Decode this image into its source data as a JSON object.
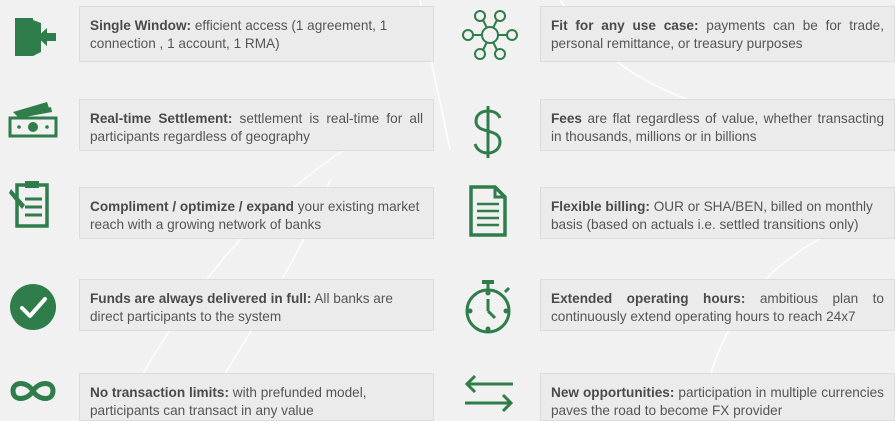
{
  "colors": {
    "green": "#2e7d4a",
    "text": "#555555",
    "box_bg": "#ebebeb"
  },
  "items": [
    {
      "icon": "door-exit-icon",
      "bold": "Single Window:",
      "text": " efficient access (1 agreement, 1 connection , 1 account, 1 RMA)"
    },
    {
      "icon": "network-people-icon",
      "bold": "Fit for any use case:",
      "text": " payments can be for trade, personal remittance, or treasury purposes"
    },
    {
      "icon": "banknotes-icon",
      "bold": "Real-time Settlement:",
      "text": " settlement is real-time for all participants regardless of geography"
    },
    {
      "icon": "dollar-icon",
      "bold": "Fees",
      "text": " are flat regardless of value, whether transacting in thousands, millions or in billions"
    },
    {
      "icon": "clipboard-edit-icon",
      "bold": "Compliment / optimize / expand",
      "text": " your existing market reach with a growing network of banks"
    },
    {
      "icon": "document-icon",
      "bold": "Flexible billing:",
      "text": " OUR or SHA/BEN, billed on monthly basis (based on actuals i.e. settled transitions only)"
    },
    {
      "icon": "check-circle-icon",
      "bold": "Funds are always delivered in full:",
      "text": " All banks are direct participants to the system"
    },
    {
      "icon": "stopwatch-icon",
      "bold": "Extended operating hours:",
      "text": " ambitious plan to continuously extend operating hours to reach 24x7"
    },
    {
      "icon": "infinity-icon",
      "bold": "No transaction limits:",
      "text": " with prefunded model, participants can transact in any value"
    },
    {
      "icon": "exchange-arrows-icon",
      "bold": "New opportunities:",
      "text": " participation in multiple currencies paves the road to become FX provider"
    }
  ]
}
